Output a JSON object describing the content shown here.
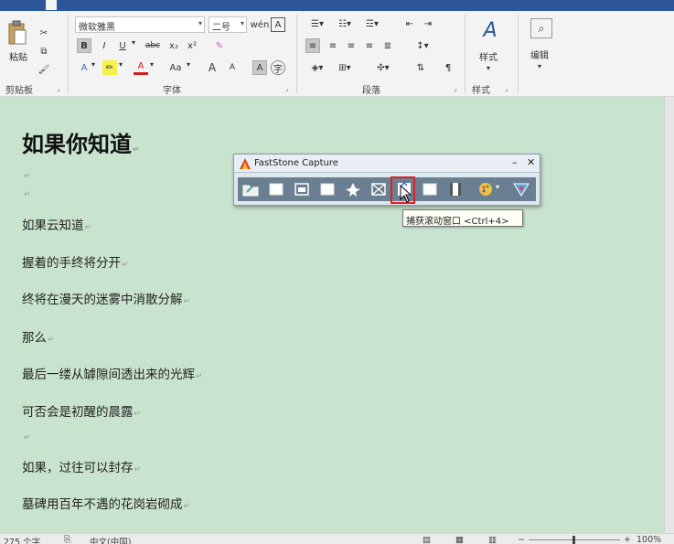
{
  "ribbon": {
    "clipboard": {
      "paste_label": "粘贴",
      "group_label": "剪贴板"
    },
    "font": {
      "font_name": "微软雅黑",
      "font_size": "二号",
      "group_label": "字体",
      "bold": "B",
      "italic": "I",
      "underline": "U",
      "strike": "abc",
      "subscript": "x₂",
      "superscript": "x²",
      "change_case": "Aa",
      "grow": "A",
      "shrink": "A"
    },
    "paragraph": {
      "group_label": "段落"
    },
    "styles": {
      "styles_label": "样式",
      "group_label": "样式"
    },
    "editing": {
      "editing_label": "编辑"
    }
  },
  "document": {
    "lines": [
      "如果你知道",
      "如果云知道",
      "握着的手终将分开",
      "终将在漫天的迷雾中消散分解",
      "那么",
      "最后一缕从罅隙间透出来的光辉",
      "可否会是初醒的晨露",
      "如果，过往可以封存",
      "墓碑用百年不遇的花岗岩砌成"
    ],
    "para_mark": "↵"
  },
  "faststone": {
    "title": "FastStone Capture",
    "tooltip": "捕获滚动窗口 <Ctrl+4>"
  },
  "status": {
    "word_count": "275 个字",
    "language": "中文(中国)",
    "zoom": "100%"
  },
  "colors": {
    "accent": "#2b579a",
    "doc_bg": "#c9e4ce",
    "highlight": "#e02020"
  }
}
